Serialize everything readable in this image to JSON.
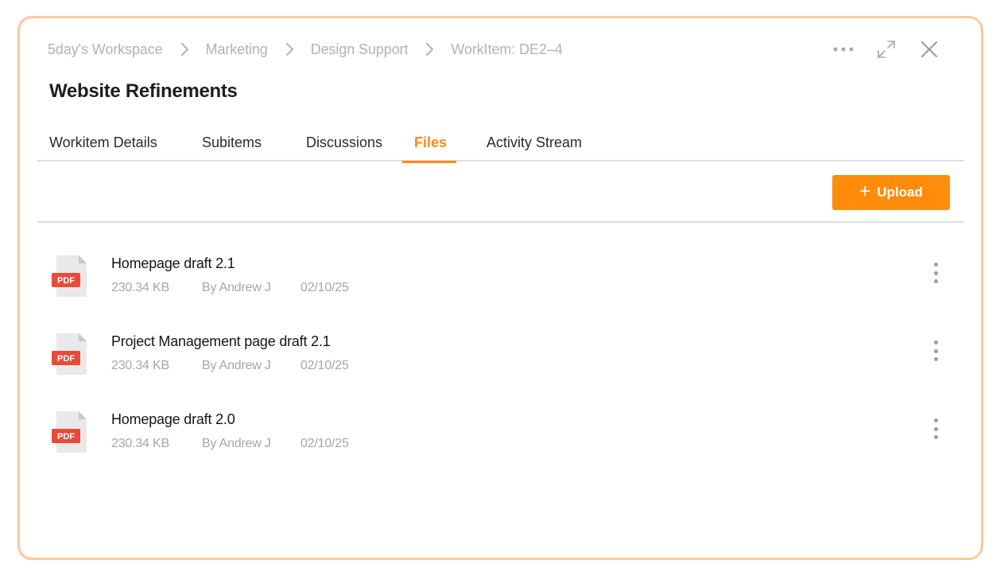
{
  "breadcrumb": {
    "items": [
      "5day's Workspace",
      "Marketing",
      "Design Support",
      "WorkItem: DE2–4"
    ]
  },
  "title": "Website Refinements",
  "tabs": [
    {
      "label": "Workitem Details",
      "active": false
    },
    {
      "label": "Subitems",
      "active": false
    },
    {
      "label": "Discussions",
      "active": false
    },
    {
      "label": "Files",
      "active": true
    },
    {
      "label": "Activity Stream",
      "active": false
    }
  ],
  "toolbar": {
    "upload_label": "Upload",
    "upload_icon": "plus-icon"
  },
  "files": [
    {
      "name": "Homepage draft 2.1",
      "size": "230.34 KB",
      "author": "By Andrew J",
      "date": "02/10/25",
      "type_badge": "PDF"
    },
    {
      "name": "Project Management page draft 2.1",
      "size": "230.34 KB",
      "author": "By Andrew J",
      "date": "02/10/25",
      "type_badge": "PDF"
    },
    {
      "name": "Homepage draft 2.0",
      "size": "230.34 KB",
      "author": "By Andrew J",
      "date": "02/10/25",
      "type_badge": "PDF"
    }
  ],
  "colors": {
    "accent": "#ff8c0a",
    "border": "#fdc89a",
    "pdf_badge": "#ea4a3a"
  },
  "icons": {
    "more": "more-horizontal-icon",
    "expand": "expand-icon",
    "close": "close-icon",
    "row_menu": "kebab-menu-icon",
    "file": "pdf-file-icon",
    "separator": "chevron-right-icon"
  }
}
